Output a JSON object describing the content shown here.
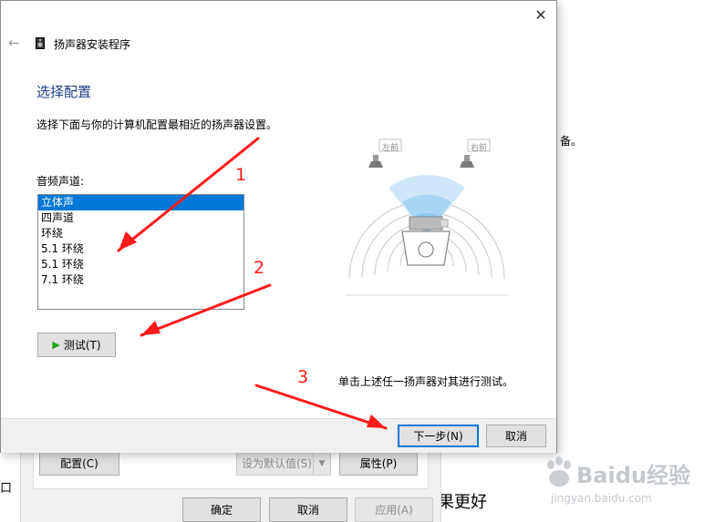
{
  "background": {
    "right_fragment": "备。",
    "left_fragment": "口",
    "bottom_text": "果更好",
    "buttons": {
      "configure": "配置(C)",
      "set_default": "设为默认值(S)",
      "properties": "属性(P)",
      "ok": "确定",
      "cancel": "取消",
      "apply": "应用(A)"
    }
  },
  "dialog": {
    "title": "扬声器安装程序",
    "heading": "选择配置",
    "description": "选择下面与你的计算机配置最相近的扬声器设置。",
    "channels_label": "音频声道:",
    "channels": [
      "立体声",
      "四声道",
      "环绕",
      "5.1 环绕",
      "5.1 环绕",
      "7.1 环绕"
    ],
    "selected_index": 0,
    "test_button": "测试(T)",
    "hint": "单击上述任一扬声器对其进行测试。",
    "speaker_labels": {
      "left": "左前",
      "right": "右前"
    },
    "footer": {
      "next": "下一步(N)",
      "cancel": "取消"
    }
  },
  "annotations": [
    "1",
    "2",
    "3"
  ],
  "watermark": {
    "brand": "Baidu经验",
    "url": "jingyan.baidu.com"
  },
  "colors": {
    "accent": "#0078d7",
    "arrow": "#ff1a1a",
    "heading": "#1f3f86"
  }
}
